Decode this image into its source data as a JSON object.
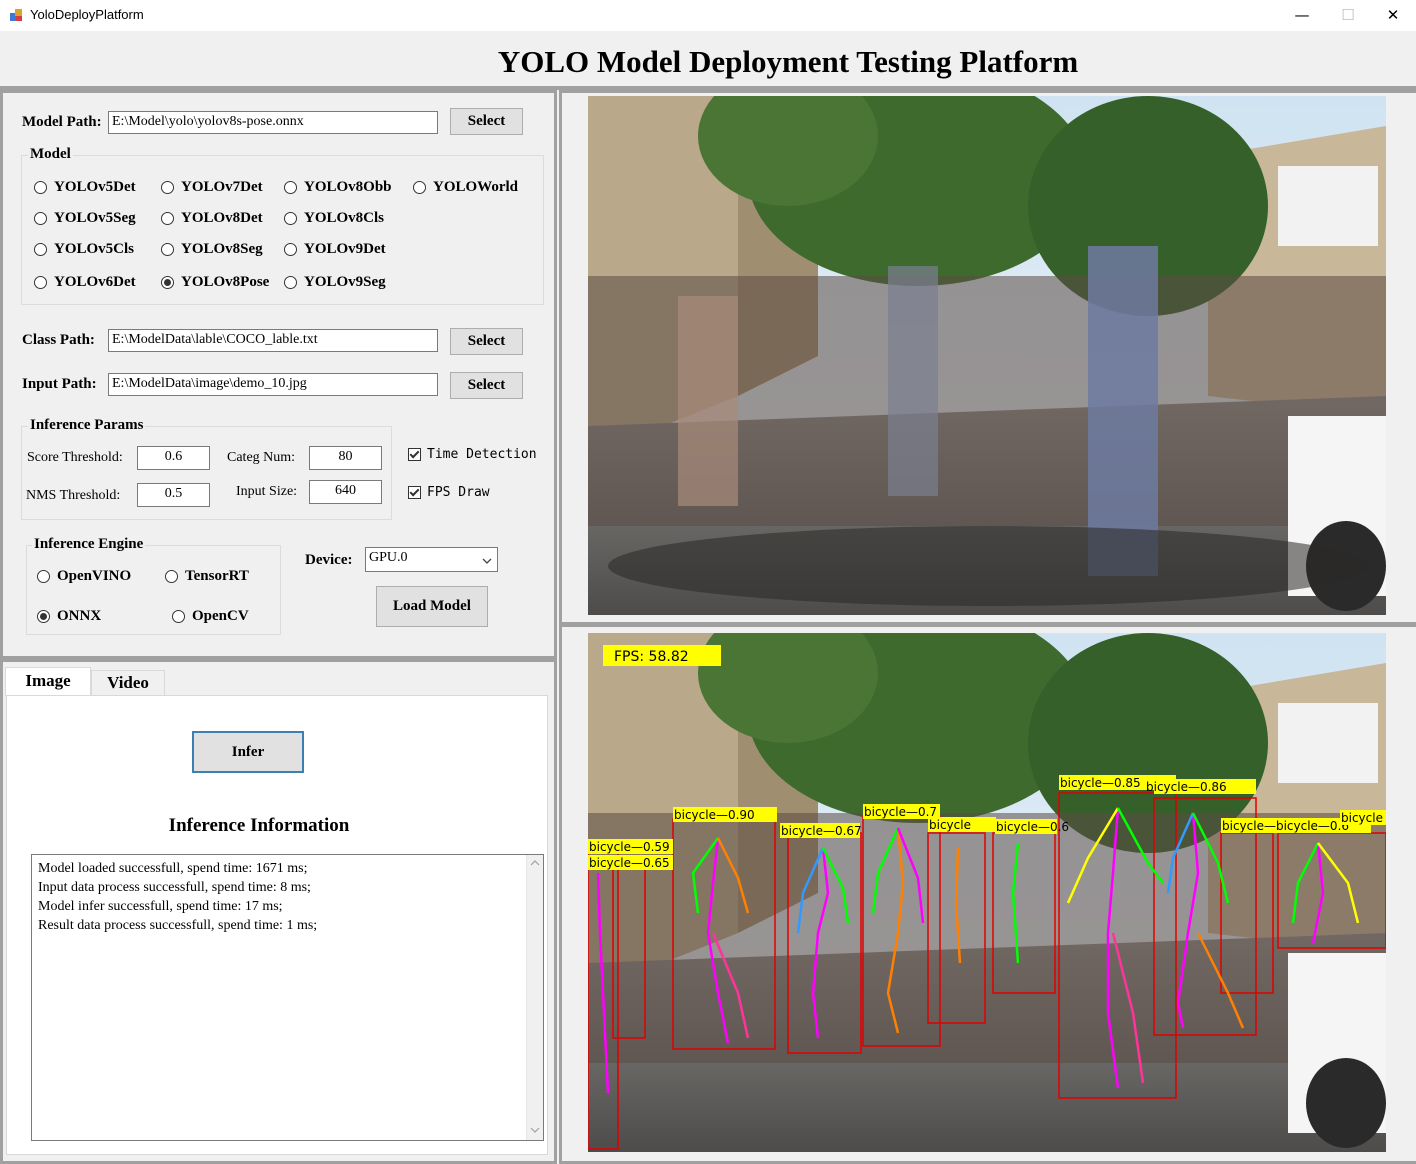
{
  "window": {
    "title": "YoloDeployPlatform",
    "minimize": "—",
    "maximize": "☐",
    "close": "✕"
  },
  "header": {
    "title": "YOLO Model Deployment Testing Platform"
  },
  "model_path": {
    "label": "Model Path:",
    "value": "E:\\Model\\yolo\\yolov8s-pose.onnx",
    "button": "Select"
  },
  "model_group": {
    "title": "Model",
    "options": [
      "YOLOv5Det",
      "YOLOv7Det",
      "YOLOv8Obb",
      "YOLOWorld",
      "YOLOv5Seg",
      "YOLOv8Det",
      "YOLOv8Cls",
      "YOLOv5Cls",
      "YOLOv8Seg",
      "YOLOv9Det",
      "YOLOv6Det",
      "YOLOv8Pose",
      "YOLOv9Seg"
    ],
    "selected": "YOLOv8Pose"
  },
  "class_path": {
    "label": "Class Path:",
    "value": "E:\\ModelData\\lable\\COCO_lable.txt",
    "button": "Select"
  },
  "input_path": {
    "label": "Input Path:",
    "value": "E:\\ModelData\\image\\demo_10.jpg",
    "button": "Select"
  },
  "params": {
    "title": "Inference Params",
    "score_label": "Score Threshold:",
    "score_value": "0.6",
    "nms_label": "NMS Threshold:",
    "nms_value": "0.5",
    "categ_label": "Categ Num:",
    "categ_value": "80",
    "size_label": "Input Size:",
    "size_value": "640"
  },
  "checks": {
    "time_detection": "Time Detection",
    "fps_draw": "FPS Draw"
  },
  "engine": {
    "title": "Inference Engine",
    "options": [
      "OpenVINO",
      "TensorRT",
      "ONNX",
      "OpenCV"
    ],
    "selected": "ONNX"
  },
  "device": {
    "label": "Device:",
    "value": "GPU.0"
  },
  "load_button": "Load Model",
  "tabs": {
    "image": "Image",
    "video": "Video"
  },
  "infer_button": "Infer",
  "info": {
    "title": "Inference Information",
    "lines": [
      "Model loaded successfull, spend time: 1671 ms;",
      "Input data process successfull, spend time: 8 ms;",
      "Model infer successfull, spend time: 17 ms;",
      "Result data process successfull, spend time: 1 ms;"
    ]
  },
  "result": {
    "fps": "FPS: 58.82",
    "labels": [
      "bicycle—0.90",
      "bicycle—0.7",
      "bicycle—0.85",
      "bicycle—0.86",
      "bicycle—0.6",
      "bicycle—0.6",
      "bicycle—0.6",
      "bicycle—0.59",
      "bicycle—0.65",
      "bicycle—0.6",
      "bicycle—0.67",
      "bicycle",
      "bicycle",
      "bicycle—bicycle—0.6"
    ]
  },
  "colors": {
    "panel": "#f0f0f0",
    "border": "#a0a0a0",
    "label_bg": "#ffff00",
    "box": "#e00000"
  }
}
